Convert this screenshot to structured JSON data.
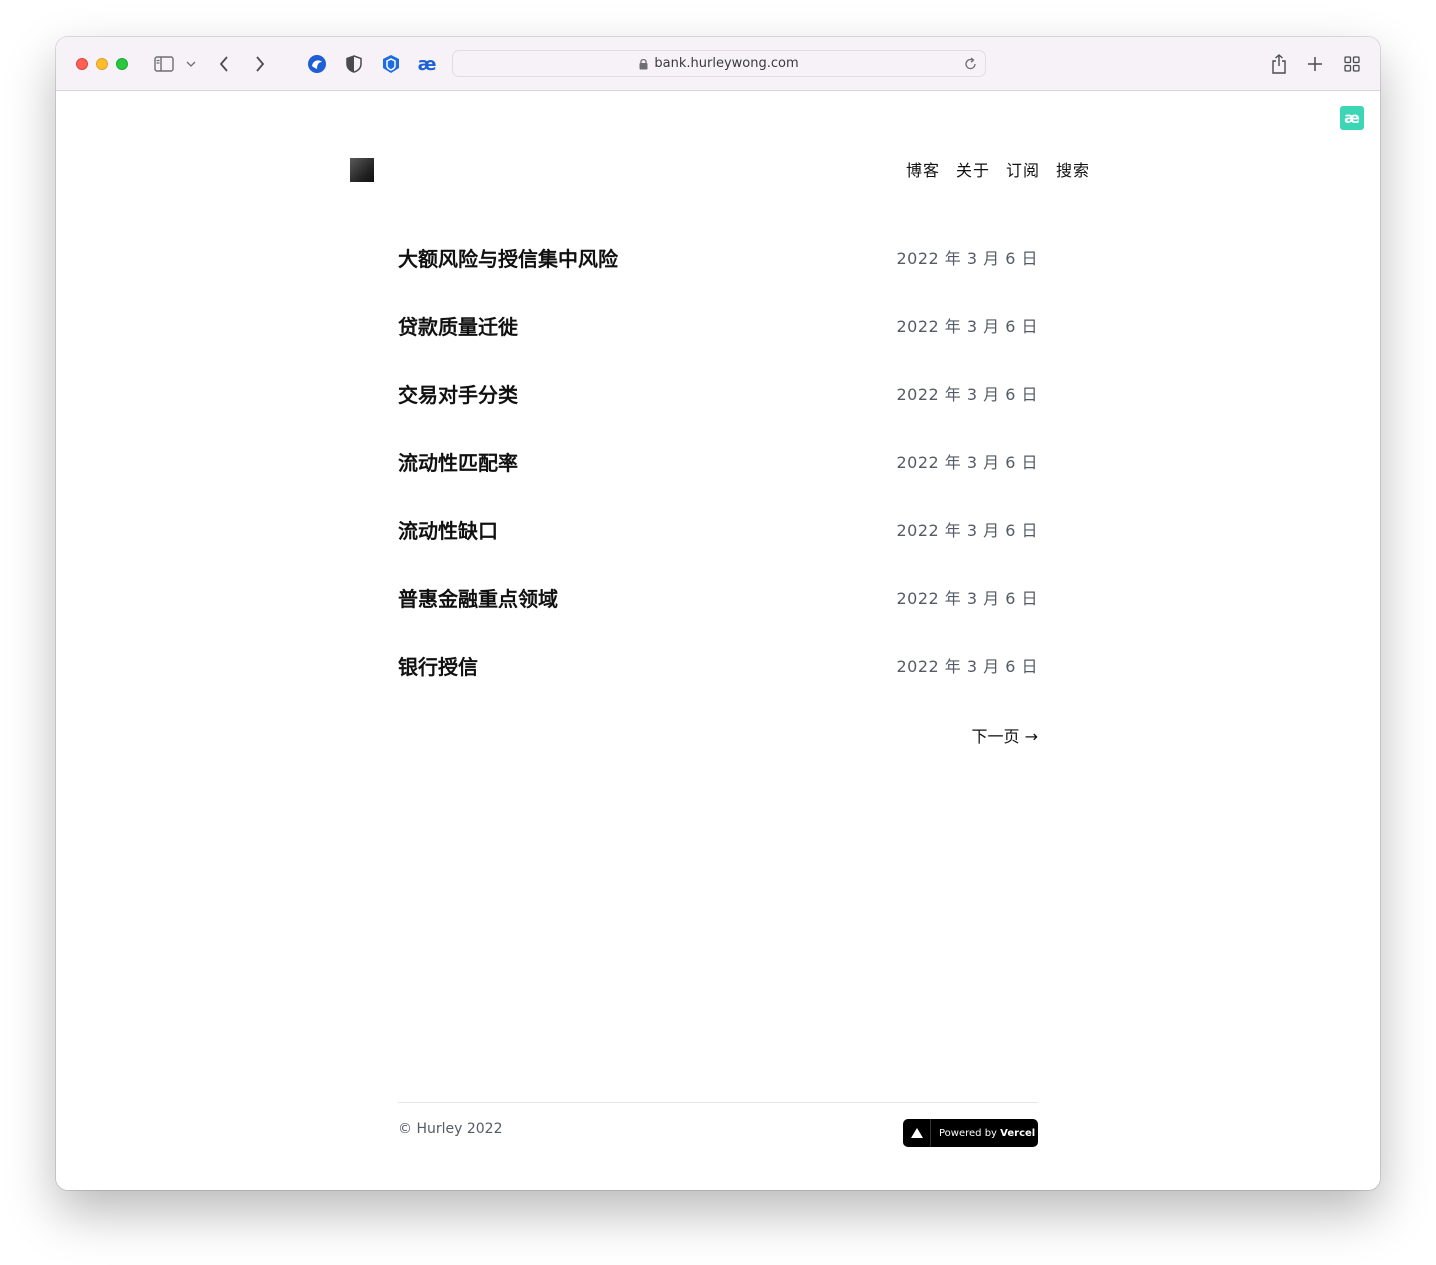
{
  "browser": {
    "url": "bank.hurleywong.com"
  },
  "extension_badge": "æ",
  "nav": {
    "items": [
      "博客",
      "关于",
      "订阅",
      "搜索"
    ]
  },
  "posts": [
    {
      "title": "大额风险与授信集中风险",
      "date": "2022 年 3 月 6 日"
    },
    {
      "title": "贷款质量迁徙",
      "date": "2022 年 3 月 6 日"
    },
    {
      "title": "交易对手分类",
      "date": "2022 年 3 月 6 日"
    },
    {
      "title": "流动性匹配率",
      "date": "2022 年 3 月 6 日"
    },
    {
      "title": "流动性缺口",
      "date": "2022 年 3 月 6 日"
    },
    {
      "title": "普惠金融重点领域",
      "date": "2022 年 3 月 6 日"
    },
    {
      "title": "银行授信",
      "date": "2022 年 3 月 6 日"
    }
  ],
  "pagination": {
    "next_label": "下一页 →"
  },
  "footer": {
    "copyright": "© Hurley 2022",
    "vercel_prefix": "Powered by",
    "vercel_brand": "Vercel"
  },
  "colors": {
    "extension_accent": "#3cd6b6",
    "toolbar_bg": "#f6f2f7"
  }
}
